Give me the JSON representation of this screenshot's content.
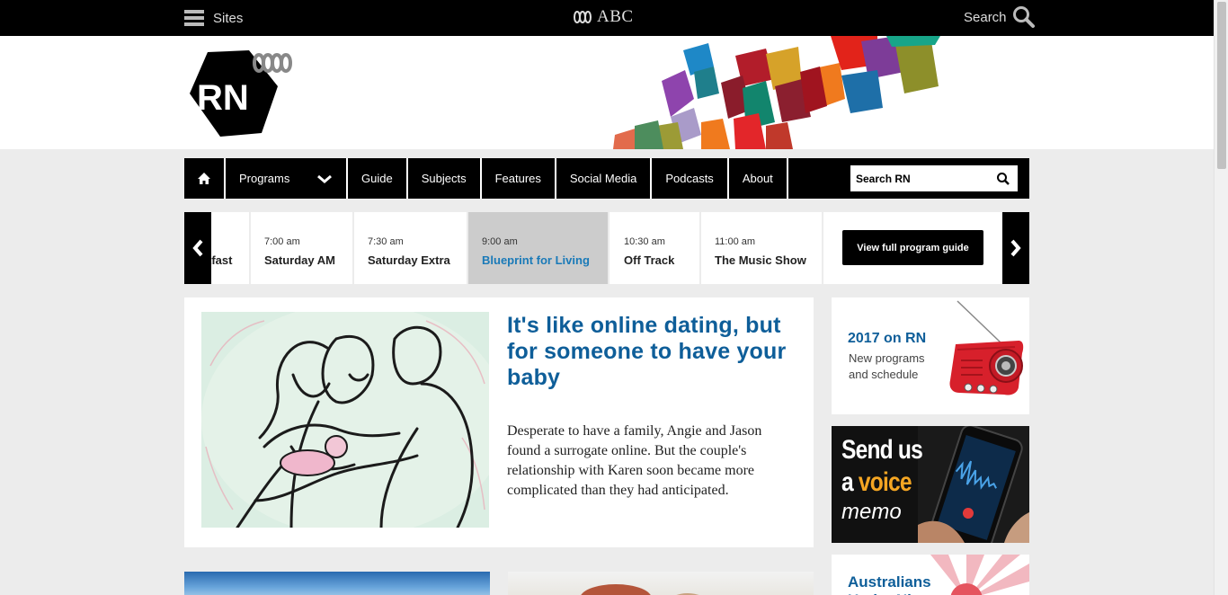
{
  "topbar": {
    "sites_label": "Sites",
    "logo_text": "ABC",
    "search_label": "Search"
  },
  "brand": {
    "logo_text": "RN"
  },
  "nav": {
    "home_label": "",
    "items": [
      "Programs",
      "Guide",
      "Subjects",
      "Features",
      "Social Media",
      "Podcasts",
      "About"
    ],
    "search_placeholder": "Search RN"
  },
  "schedule": {
    "slots": [
      {
        "time": "",
        "title": "tfast"
      },
      {
        "time": "7:00 am",
        "title": "Saturday AM"
      },
      {
        "time": "7:30 am",
        "title": "Saturday Extra"
      },
      {
        "time": "9:00 am",
        "title": "Blueprint for Living",
        "current": true
      },
      {
        "time": "10:30 am",
        "title": "Off Track"
      },
      {
        "time": "11:00 am",
        "title": "The Music Show"
      }
    ],
    "guide_button": "View full program guide"
  },
  "feature": {
    "headline": "It's like online dating, but for someone to have your baby",
    "summary": "Desperate to have a family, Angie and Jason found a surrogate online. But the couple's relationship with Karen soon became more complicated than they had anticipated."
  },
  "sidebar": {
    "promo1_title": "2017 on RN",
    "promo1_text": "New programs and schedule",
    "promo2_line1": "Send us",
    "promo2_line2_a": "a",
    "promo2_line2_b": "voice",
    "promo2_line3": "memo",
    "promo3_title": "Australians Under Ni"
  },
  "colors": {
    "brand_blue": "#0e5e99",
    "current_slot_blue": "#1a7ab8",
    "accent_orange": "#f5a623"
  }
}
